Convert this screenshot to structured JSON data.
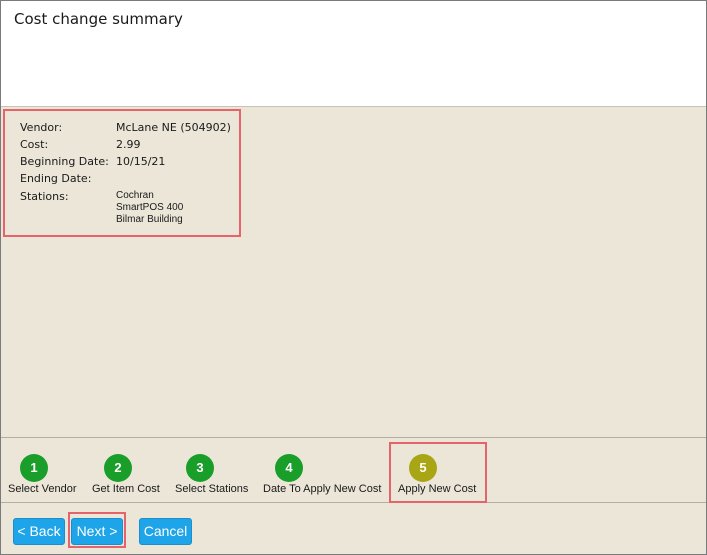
{
  "header": {
    "title": "Cost change summary"
  },
  "summary": {
    "vendor_label": "Vendor:",
    "vendor_value": "McLane NE (504902)",
    "cost_label": "Cost:",
    "cost_value": "2.99",
    "beginning_date_label": "Beginning Date:",
    "beginning_date_value": "10/15/21",
    "ending_date_label": "Ending Date:",
    "ending_date_value": "",
    "stations_label": "Stations:",
    "stations": [
      "Cochran",
      "SmartPOS 400",
      "Bilmar Building"
    ]
  },
  "steps": [
    {
      "number": "1",
      "label": "Select Vendor",
      "state": "done"
    },
    {
      "number": "2",
      "label": "Get Item Cost",
      "state": "done"
    },
    {
      "number": "3",
      "label": "Select Stations",
      "state": "done"
    },
    {
      "number": "4",
      "label": "Date To Apply New Cost",
      "state": "done"
    },
    {
      "number": "5",
      "label": "Apply New Cost",
      "state": "current"
    }
  ],
  "buttons": {
    "back": "< Back",
    "next": "Next >",
    "cancel": "Cancel"
  },
  "colors": {
    "step_done": "#1a9e2a",
    "step_current": "#a8a614",
    "button": "#1ea4e8",
    "highlight": "#e5636a",
    "panel_bg": "#ebe6d8"
  }
}
